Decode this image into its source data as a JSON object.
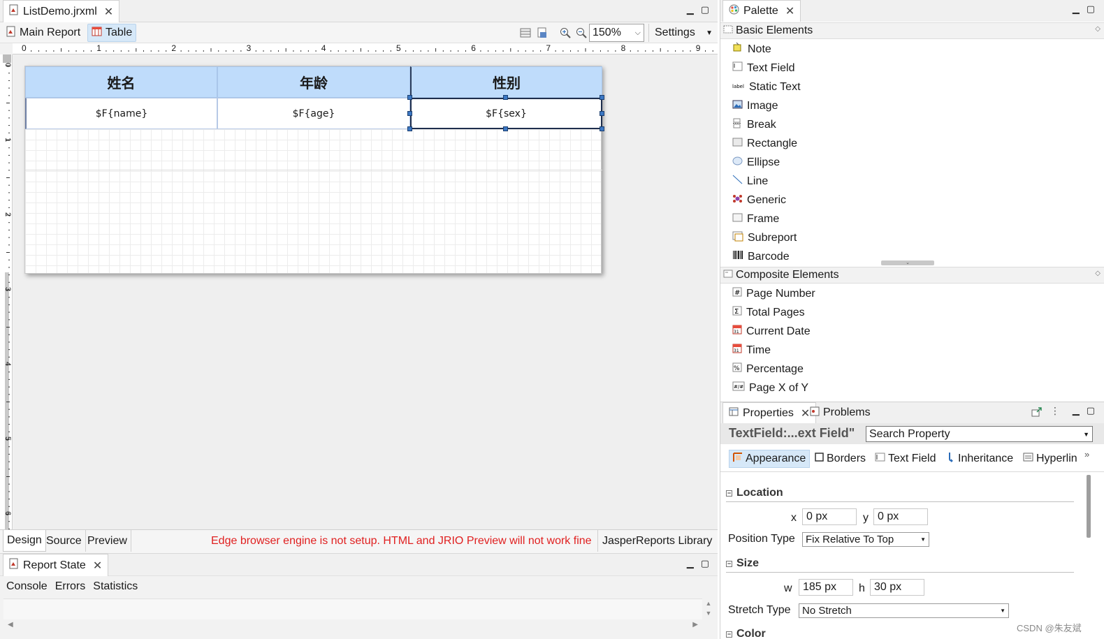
{
  "editor": {
    "file_tab": "ListDemo.jrxml",
    "crumbs": [
      "Main Report",
      "Table"
    ],
    "zoom": "150%",
    "settings_label": "Settings",
    "ruler_h": [
      "0",
      "1",
      "2",
      "3",
      "4",
      "5",
      "6",
      "7",
      "8",
      "9"
    ],
    "ruler_v": [
      "0",
      "1",
      "2",
      "3",
      "4",
      "5",
      "6"
    ],
    "table": {
      "headers": [
        "姓名",
        "年龄",
        "性别"
      ],
      "fields": [
        "$F{name}",
        "$F{age}",
        "$F{sex}"
      ]
    },
    "bottom_tabs": [
      "Design",
      "Source",
      "Preview"
    ],
    "warning": "Edge browser engine is not setup. HTML and JRIO Preview will not work fine",
    "library_label": "JasperReports Library"
  },
  "report_state": {
    "title": "Report State",
    "tabs": [
      "Console",
      "Errors",
      "Statistics"
    ]
  },
  "palette": {
    "title": "Palette",
    "basic_title": "Basic Elements",
    "basic_items": [
      "Note",
      "Text Field",
      "Static Text",
      "Image",
      "Break",
      "Rectangle",
      "Ellipse",
      "Line",
      "Generic",
      "Frame",
      "Subreport",
      "Barcode"
    ],
    "composite_title": "Composite Elements",
    "composite_items": [
      "Page Number",
      "Total Pages",
      "Current Date",
      "Time",
      "Percentage",
      "Page X of Y"
    ]
  },
  "properties": {
    "tab_properties": "Properties",
    "tab_problems": "Problems",
    "element_title": "TextField:...ext Field\"",
    "search_placeholder": "Search Property",
    "subtabs": [
      "Appearance",
      "Borders",
      "Text Field",
      "Inheritance",
      "Hyperlin"
    ],
    "location_header": "Location",
    "x_label": "x",
    "x_value": "0 px",
    "y_label": "y",
    "y_value": "0 px",
    "position_type_label": "Position Type",
    "position_type_value": "Fix Relative To Top",
    "size_header": "Size",
    "w_label": "w",
    "w_value": "185 px",
    "h_label": "h",
    "h_value": "30 px",
    "stretch_type_label": "Stretch Type",
    "stretch_type_value": "No Stretch",
    "color_header": "Color"
  },
  "watermark": "CSDN @朱友斌"
}
